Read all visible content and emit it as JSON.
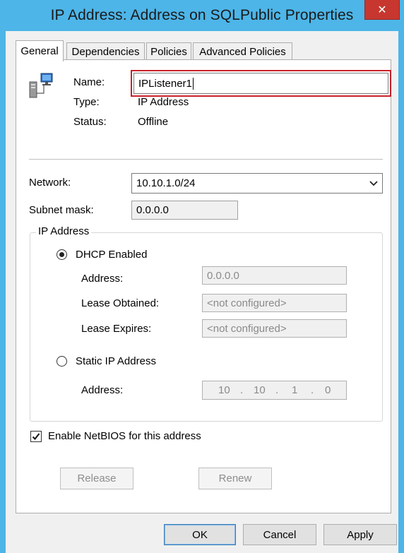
{
  "window": {
    "title": "IP Address: Address on SQLPublic Properties",
    "close_glyph": "✕"
  },
  "tabs": [
    {
      "label": "General",
      "active": true
    },
    {
      "label": "Dependencies",
      "active": false
    },
    {
      "label": "Policies",
      "active": false
    },
    {
      "label": "Advanced Policies",
      "active": false
    }
  ],
  "general": {
    "name_label": "Name:",
    "name_value": "IPListener1",
    "type_label": "Type:",
    "type_value": "IP Address",
    "status_label": "Status:",
    "status_value": "Offline",
    "network_label": "Network:",
    "network_value": "10.10.1.0/24",
    "subnet_label": "Subnet mask:",
    "subnet_value": "0.0.0.0",
    "ip_group_label": "IP Address",
    "dhcp_label": "DHCP Enabled",
    "dhcp_selected": true,
    "dhcp_address_label": "Address:",
    "dhcp_address_value": "0.0.0.0",
    "lease_obtained_label": "Lease Obtained:",
    "lease_obtained_value": "<not configured>",
    "lease_expires_label": "Lease Expires:",
    "lease_expires_value": "<not configured>",
    "static_label": "Static IP Address",
    "static_selected": false,
    "static_address_label": "Address:",
    "static_octets": [
      "10",
      "10",
      "1",
      "0"
    ],
    "ip_dot": ".",
    "netbios_label": "Enable NetBIOS for this address",
    "netbios_checked": true,
    "release_label": "Release",
    "renew_label": "Renew"
  },
  "footer": {
    "ok_label": "OK",
    "cancel_label": "Cancel",
    "apply_label": "Apply"
  },
  "colors": {
    "title_bar": "#4db5e8",
    "close_button": "#c7372f",
    "highlight_box": "#c8202a",
    "dialog_bg": "#f0f0f0"
  }
}
